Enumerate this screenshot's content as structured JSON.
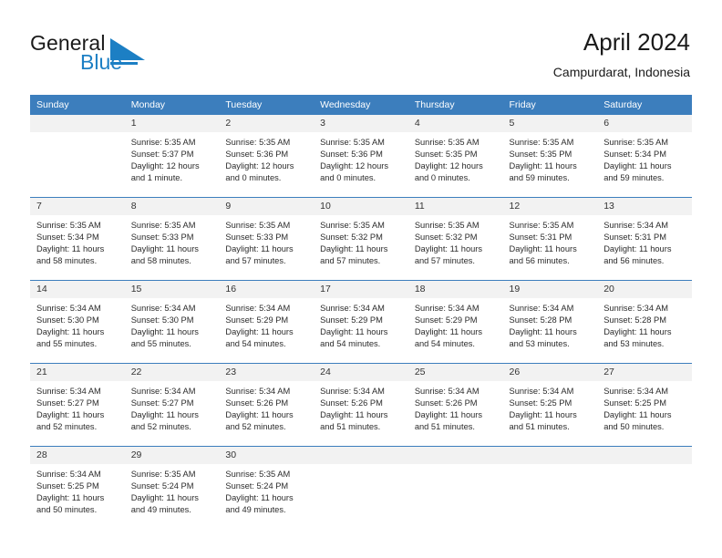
{
  "brand": {
    "word_one": "General",
    "word_two": "Blue",
    "mark_color": "#1c7fc4",
    "text_color": "#1a1a1a"
  },
  "header": {
    "title": "April 2024",
    "subtitle": "Campurdarat, Indonesia",
    "accent_color": "#3c7ebd",
    "band_color": "#f2f2f2"
  },
  "weekday_headers": [
    "Sunday",
    "Monday",
    "Tuesday",
    "Wednesday",
    "Thursday",
    "Friday",
    "Saturday"
  ],
  "weeks": [
    [
      {
        "day": "",
        "lines": []
      },
      {
        "day": "1",
        "lines": [
          "Sunrise: 5:35 AM",
          "Sunset: 5:37 PM",
          "Daylight: 12 hours",
          "and 1 minute."
        ]
      },
      {
        "day": "2",
        "lines": [
          "Sunrise: 5:35 AM",
          "Sunset: 5:36 PM",
          "Daylight: 12 hours",
          "and 0 minutes."
        ]
      },
      {
        "day": "3",
        "lines": [
          "Sunrise: 5:35 AM",
          "Sunset: 5:36 PM",
          "Daylight: 12 hours",
          "and 0 minutes."
        ]
      },
      {
        "day": "4",
        "lines": [
          "Sunrise: 5:35 AM",
          "Sunset: 5:35 PM",
          "Daylight: 12 hours",
          "and 0 minutes."
        ]
      },
      {
        "day": "5",
        "lines": [
          "Sunrise: 5:35 AM",
          "Sunset: 5:35 PM",
          "Daylight: 11 hours",
          "and 59 minutes."
        ]
      },
      {
        "day": "6",
        "lines": [
          "Sunrise: 5:35 AM",
          "Sunset: 5:34 PM",
          "Daylight: 11 hours",
          "and 59 minutes."
        ]
      }
    ],
    [
      {
        "day": "7",
        "lines": [
          "Sunrise: 5:35 AM",
          "Sunset: 5:34 PM",
          "Daylight: 11 hours",
          "and 58 minutes."
        ]
      },
      {
        "day": "8",
        "lines": [
          "Sunrise: 5:35 AM",
          "Sunset: 5:33 PM",
          "Daylight: 11 hours",
          "and 58 minutes."
        ]
      },
      {
        "day": "9",
        "lines": [
          "Sunrise: 5:35 AM",
          "Sunset: 5:33 PM",
          "Daylight: 11 hours",
          "and 57 minutes."
        ]
      },
      {
        "day": "10",
        "lines": [
          "Sunrise: 5:35 AM",
          "Sunset: 5:32 PM",
          "Daylight: 11 hours",
          "and 57 minutes."
        ]
      },
      {
        "day": "11",
        "lines": [
          "Sunrise: 5:35 AM",
          "Sunset: 5:32 PM",
          "Daylight: 11 hours",
          "and 57 minutes."
        ]
      },
      {
        "day": "12",
        "lines": [
          "Sunrise: 5:35 AM",
          "Sunset: 5:31 PM",
          "Daylight: 11 hours",
          "and 56 minutes."
        ]
      },
      {
        "day": "13",
        "lines": [
          "Sunrise: 5:34 AM",
          "Sunset: 5:31 PM",
          "Daylight: 11 hours",
          "and 56 minutes."
        ]
      }
    ],
    [
      {
        "day": "14",
        "lines": [
          "Sunrise: 5:34 AM",
          "Sunset: 5:30 PM",
          "Daylight: 11 hours",
          "and 55 minutes."
        ]
      },
      {
        "day": "15",
        "lines": [
          "Sunrise: 5:34 AM",
          "Sunset: 5:30 PM",
          "Daylight: 11 hours",
          "and 55 minutes."
        ]
      },
      {
        "day": "16",
        "lines": [
          "Sunrise: 5:34 AM",
          "Sunset: 5:29 PM",
          "Daylight: 11 hours",
          "and 54 minutes."
        ]
      },
      {
        "day": "17",
        "lines": [
          "Sunrise: 5:34 AM",
          "Sunset: 5:29 PM",
          "Daylight: 11 hours",
          "and 54 minutes."
        ]
      },
      {
        "day": "18",
        "lines": [
          "Sunrise: 5:34 AM",
          "Sunset: 5:29 PM",
          "Daylight: 11 hours",
          "and 54 minutes."
        ]
      },
      {
        "day": "19",
        "lines": [
          "Sunrise: 5:34 AM",
          "Sunset: 5:28 PM",
          "Daylight: 11 hours",
          "and 53 minutes."
        ]
      },
      {
        "day": "20",
        "lines": [
          "Sunrise: 5:34 AM",
          "Sunset: 5:28 PM",
          "Daylight: 11 hours",
          "and 53 minutes."
        ]
      }
    ],
    [
      {
        "day": "21",
        "lines": [
          "Sunrise: 5:34 AM",
          "Sunset: 5:27 PM",
          "Daylight: 11 hours",
          "and 52 minutes."
        ]
      },
      {
        "day": "22",
        "lines": [
          "Sunrise: 5:34 AM",
          "Sunset: 5:27 PM",
          "Daylight: 11 hours",
          "and 52 minutes."
        ]
      },
      {
        "day": "23",
        "lines": [
          "Sunrise: 5:34 AM",
          "Sunset: 5:26 PM",
          "Daylight: 11 hours",
          "and 52 minutes."
        ]
      },
      {
        "day": "24",
        "lines": [
          "Sunrise: 5:34 AM",
          "Sunset: 5:26 PM",
          "Daylight: 11 hours",
          "and 51 minutes."
        ]
      },
      {
        "day": "25",
        "lines": [
          "Sunrise: 5:34 AM",
          "Sunset: 5:26 PM",
          "Daylight: 11 hours",
          "and 51 minutes."
        ]
      },
      {
        "day": "26",
        "lines": [
          "Sunrise: 5:34 AM",
          "Sunset: 5:25 PM",
          "Daylight: 11 hours",
          "and 51 minutes."
        ]
      },
      {
        "day": "27",
        "lines": [
          "Sunrise: 5:34 AM",
          "Sunset: 5:25 PM",
          "Daylight: 11 hours",
          "and 50 minutes."
        ]
      }
    ],
    [
      {
        "day": "28",
        "lines": [
          "Sunrise: 5:34 AM",
          "Sunset: 5:25 PM",
          "Daylight: 11 hours",
          "and 50 minutes."
        ]
      },
      {
        "day": "29",
        "lines": [
          "Sunrise: 5:35 AM",
          "Sunset: 5:24 PM",
          "Daylight: 11 hours",
          "and 49 minutes."
        ]
      },
      {
        "day": "30",
        "lines": [
          "Sunrise: 5:35 AM",
          "Sunset: 5:24 PM",
          "Daylight: 11 hours",
          "and 49 minutes."
        ]
      },
      {
        "day": "",
        "lines": []
      },
      {
        "day": "",
        "lines": []
      },
      {
        "day": "",
        "lines": []
      },
      {
        "day": "",
        "lines": []
      }
    ]
  ]
}
